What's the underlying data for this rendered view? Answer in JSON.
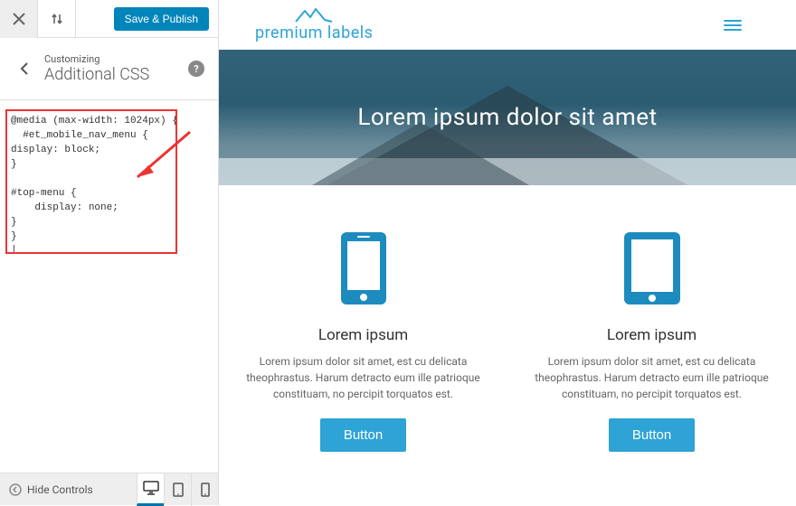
{
  "customizer": {
    "save_label": "Save & Publish",
    "customizing_label": "Customizing",
    "section_title": "Additional CSS",
    "css_value": "@media (max-width: 1024px) {\n  #et_mobile_nav_menu {\ndisplay: block;\n}\n\n#top-menu {\n    display: none;\n}\n}\n|",
    "hide_controls_label": "Hide Controls"
  },
  "preview": {
    "logo_text": "premium labels",
    "hero_title": "Lorem ipsum dolor sit amet",
    "cards": [
      {
        "title": "Lorem ipsum",
        "body": "Lorem ipsum dolor sit amet, est cu delicata theophrastus. Harum detracto eum ille patrioque constituam, no percipit torquatos est.",
        "button": "Button"
      },
      {
        "title": "Lorem ipsum",
        "body": "Lorem ipsum dolor sit amet, est cu delicata theophrastus. Harum detracto eum ille patrioque constituam, no percipit torquatos est.",
        "button": "Button"
      }
    ]
  },
  "colors": {
    "accent": "#2ea3d6",
    "wp_blue": "#0085ba"
  }
}
